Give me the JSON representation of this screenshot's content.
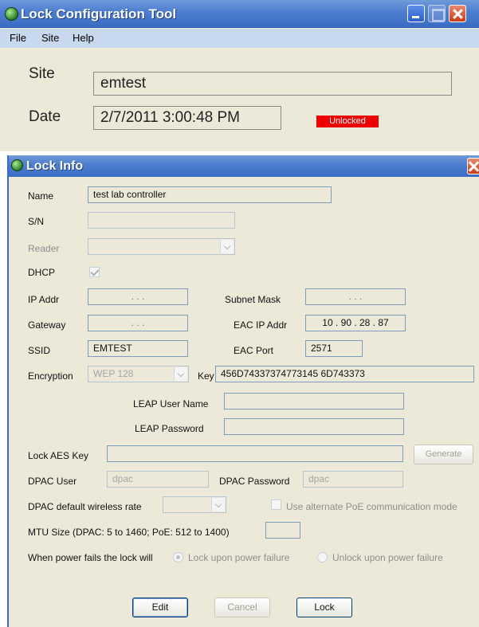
{
  "main_window": {
    "title": "Lock Configuration Tool",
    "menu": [
      "File",
      "Site",
      "Help"
    ],
    "site_label": "Site",
    "site_value": "emtest",
    "date_label": "Date",
    "date_value": "2/7/2011 3:00:48 PM",
    "status": "Unlocked",
    "status_color": "#ee0000"
  },
  "dialog": {
    "title": "Lock Info",
    "name_label": "Name",
    "name_value": "test lab controller",
    "sn_label": "S/N",
    "sn_value": "",
    "reader_label": "Reader",
    "reader_value": "",
    "dhcp_label": "DHCP",
    "dhcp_checked": true,
    "ip_label": "IP Addr",
    "ip_value": ". . .",
    "subnet_label": "Subnet Mask",
    "subnet_value": ". . .",
    "gateway_label": "Gateway",
    "gateway_value": ". . .",
    "eac_ip_label": "EAC IP Addr",
    "eac_ip_value": "10 . 90 . 28 . 87",
    "ssid_label": "SSID",
    "ssid_value": "EMTEST",
    "eac_port_label": "EAC Port",
    "eac_port_value": "2571",
    "encryption_label": "Encryption",
    "encryption_value": "WEP 128",
    "key_label": "Key",
    "key_value": "456D74337374773145 6D743373",
    "leap_user_label": "LEAP User Name",
    "leap_user_value": "",
    "leap_password_label": "LEAP Password",
    "leap_password_value": "",
    "aes_label": "Lock AES Key",
    "aes_value": "",
    "generate_label": "Generate",
    "dpac_user_label": "DPAC User",
    "dpac_user_value": "dpac",
    "dpac_password_label": "DPAC Password",
    "dpac_password_value": "dpac",
    "wireless_rate_label": "DPAC default wireless rate",
    "wireless_rate_value": "",
    "alt_poe_label": "Use alternate PoE communication mode",
    "mtu_label": "MTU Size (DPAC: 5 to 1460; PoE: 512 to 1400)",
    "mtu_value": "",
    "power_fail_label": "When power fails the lock will",
    "lock_on_fail_label": "Lock upon power failure",
    "unlock_on_fail_label": "Unlock upon power failure",
    "edit_label": "Edit",
    "cancel_label": "Cancel",
    "lock_label": "Lock"
  }
}
